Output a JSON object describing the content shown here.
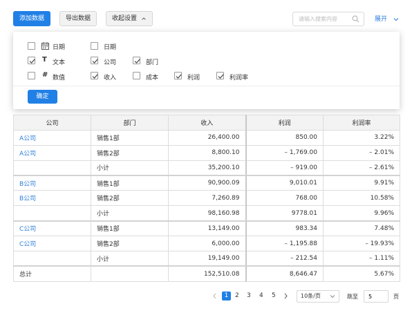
{
  "toolbar": {
    "add_label": "添加数据",
    "export_label": "导出数据",
    "settings_label": "收起设置",
    "search_placeholder": "请输入搜索内容",
    "expand_label": "展开"
  },
  "fields": [
    {
      "type_icon": "calendar-icon",
      "label": "日期",
      "checked": false
    },
    {
      "type_icon": "",
      "label": "日期",
      "checked": false
    },
    {
      "type_icon": "T",
      "label": "文本",
      "checked": true
    },
    {
      "type_icon": "",
      "label": "公司",
      "checked": true
    },
    {
      "type_icon": "",
      "label": "部门",
      "checked": true
    },
    {
      "type_icon": "#",
      "label": "数值",
      "checked": false
    },
    {
      "type_icon": "",
      "label": "收入",
      "checked": true
    },
    {
      "type_icon": "",
      "label": "成本",
      "checked": false
    },
    {
      "type_icon": "",
      "label": "利润",
      "checked": true
    },
    {
      "type_icon": "",
      "label": "利润率",
      "checked": true
    }
  ],
  "confirm_label": "确定",
  "table": {
    "headers": [
      "公司",
      "部门",
      "收入",
      "利润",
      "利润率"
    ],
    "rows": [
      [
        "A公司",
        "销售1部",
        "26,400.00",
        "850.00",
        "3.22%"
      ],
      [
        "A公司",
        "销售2部",
        "8,800.10",
        "– 1,769.00",
        "– 2.01%"
      ],
      [
        "",
        "小计",
        "35,200.10",
        "– 919.00",
        "– 2.61%"
      ],
      [
        "B公司",
        "销售1部",
        "90,900.09",
        "9,010.01",
        "9.91%"
      ],
      [
        "B公司",
        "销售2部",
        "7,260.89",
        "768.00",
        "10.58%"
      ],
      [
        "",
        "小计",
        "98,160.98",
        "9778.01",
        "9.96%"
      ],
      [
        "C公司",
        "销售1部",
        "13,149.00",
        "983.34",
        "7.48%"
      ],
      [
        "C公司",
        "销售2部",
        "6,000.00",
        "– 1,195.88",
        "– 19.93%"
      ],
      [
        "",
        "小计",
        "19,149.00",
        "– 212.54",
        "– 1.11%"
      ],
      [
        "总计",
        "",
        "152,510.08",
        "8,646.47",
        "5.67%"
      ]
    ]
  },
  "pagination": {
    "pages": [
      "1",
      "2",
      "3",
      "4",
      "5"
    ],
    "current": "1",
    "page_size": "10条/页",
    "goto_label": "跳至",
    "goto_value": "5",
    "page_unit": "页"
  },
  "colors": {
    "primary": "#2180e6",
    "link": "#2f7ed8"
  }
}
